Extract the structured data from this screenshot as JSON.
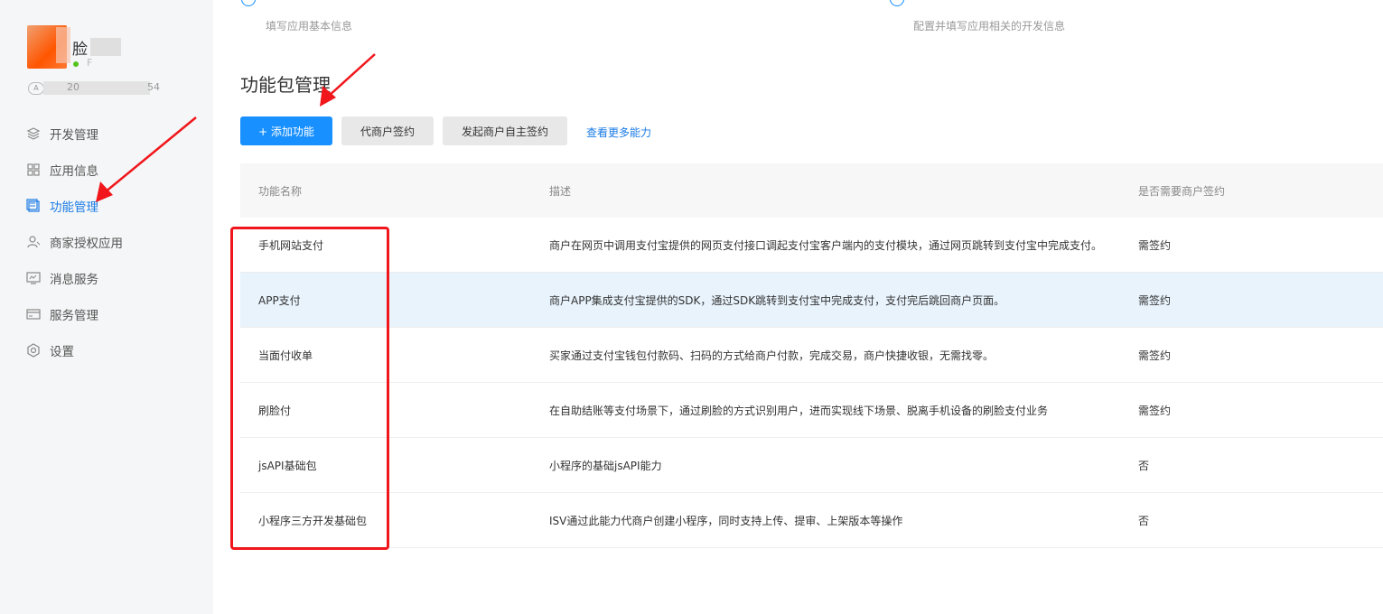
{
  "user": {
    "name_char": "脸",
    "status_text": "F",
    "app_tag": "A",
    "app_id_part1": "20",
    "app_id_part2": "54"
  },
  "sidebar": {
    "items": [
      {
        "label": "开发管理",
        "icon": "layers-icon"
      },
      {
        "label": "应用信息",
        "icon": "grid-icon"
      },
      {
        "label": "功能管理",
        "icon": "feature-icon",
        "active": true
      },
      {
        "label": "商家授权应用",
        "icon": "user-icon"
      },
      {
        "label": "消息服务",
        "icon": "monitor-icon"
      },
      {
        "label": "服务管理",
        "icon": "card-icon"
      },
      {
        "label": "设置",
        "icon": "gear-icon"
      }
    ]
  },
  "steps": [
    {
      "desc": "填写应用基本信息"
    },
    {
      "desc": "配置并填写应用相关的开发信息"
    }
  ],
  "section": {
    "title": "功能包管理"
  },
  "actions": {
    "add_feature": "+ 添加功能",
    "agent_sign": "代商户签约",
    "merchant_self_sign": "发起商户自主签约",
    "more_link": "查看更多能力"
  },
  "table": {
    "headers": [
      "功能名称",
      "描述",
      "是否需要商户签约"
    ],
    "rows": [
      {
        "name": "手机网站支付",
        "desc": "商户在网页中调用支付宝提供的网页支付接口调起支付宝客户端内的支付模块，通过网页跳转到支付宝中完成支付。",
        "sign": "需签约"
      },
      {
        "name": "APP支付",
        "desc": "商户APP集成支付宝提供的SDK，通过SDK跳转到支付宝中完成支付，支付完后跳回商户页面。",
        "sign": "需签约"
      },
      {
        "name": "当面付收单",
        "desc": "买家通过支付宝钱包付款码、扫码的方式给商户付款，完成交易，商户快捷收银，无需找零。",
        "sign": "需签约"
      },
      {
        "name": "刷脸付",
        "desc": "在自助结账等支付场景下，通过刷脸的方式识别用户，进而实现线下场景、脱离手机设备的刷脸支付业务",
        "sign": "需签约"
      },
      {
        "name": "jsAPI基础包",
        "desc": "小程序的基础jsAPI能力",
        "sign": "否"
      },
      {
        "name": "小程序三方开发基础包",
        "desc": "ISV通过此能力代商户创建小程序，同时支持上传、提审、上架版本等操作",
        "sign": "否"
      }
    ]
  },
  "colors": {
    "primary": "#1890ff",
    "active_menu": "#1a7be6",
    "annotation_red": "#f0161b",
    "row_highlight": "#e8f3fc"
  }
}
